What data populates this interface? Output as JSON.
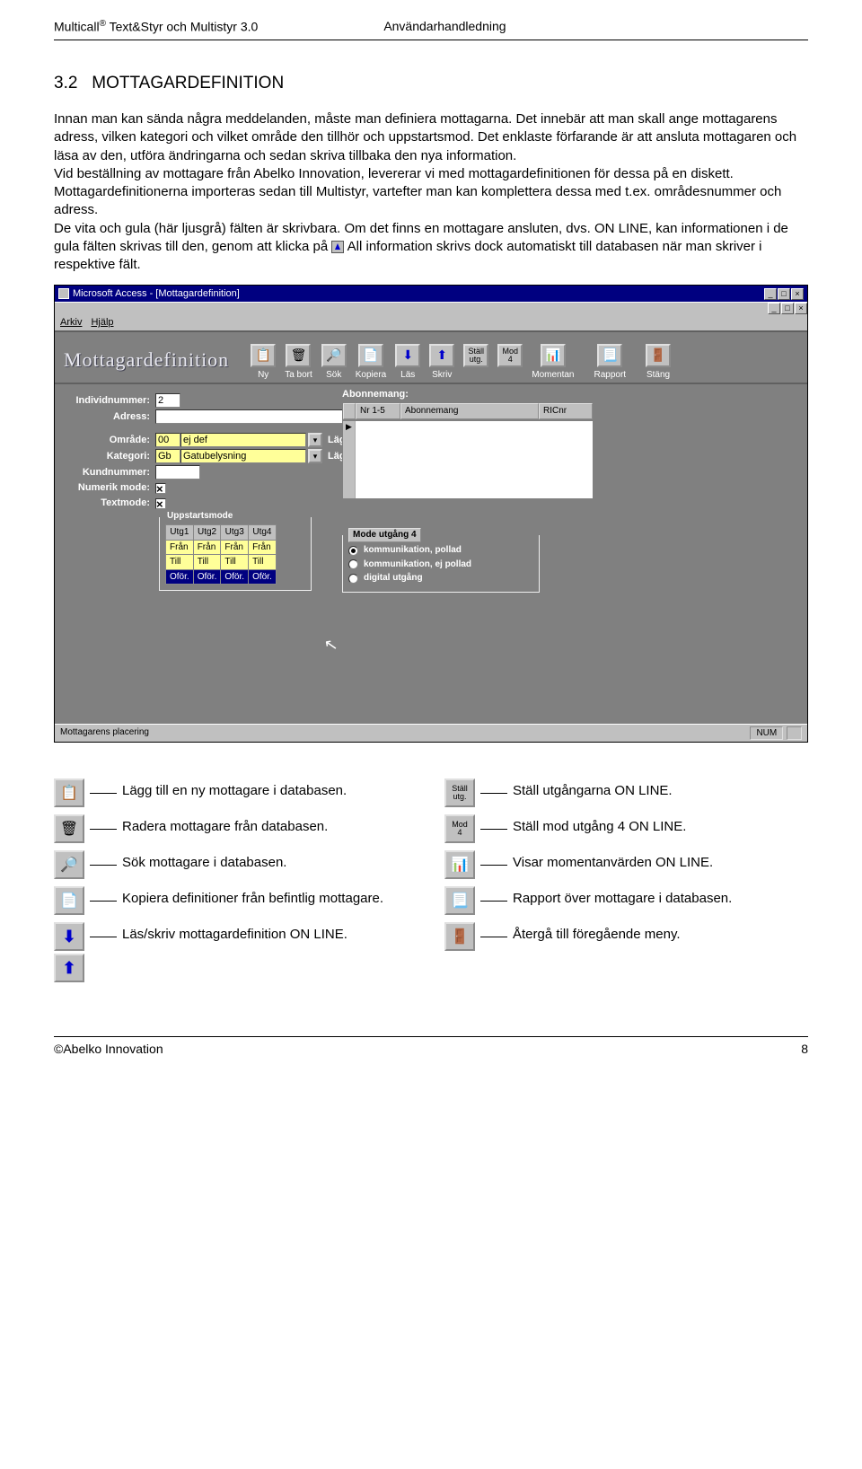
{
  "header": {
    "left_a": "Multicall",
    "left_sup": "®",
    "left_b": "Text&Styr och Multistyr 3.0",
    "right": "Användarhandledning"
  },
  "section": {
    "number": "3.2",
    "title": "MOTTAGARDEFINITION"
  },
  "body_text": "Innan man kan sända några meddelanden, måste man definiera mottagarna. Det innebär att man skall ange mottagarens adress, vilken kategori och vilket område den tillhör och uppstartsmod. Det enklaste förfarande är att ansluta mottagaren och läsa av den, utföra ändringarna och sedan skriva tillbaka den nya information.\nVid beställning av mottagare från Abelko Innovation, levererar vi med mottagardefinitionen för dessa på en diskett. Mottagardefinitionerna importeras sedan till Multistyr, vartefter man kan komplettera dessa med t.ex. områdesnummer och adress.\nDe vita och gula (här ljusgrå) fälten är skrivbara. Om det finns en mottagare ansluten, dvs. ON LINE, kan informationen i de gula fälten skrivas till den, genom att klicka på ",
  "body_text_after": " All information skrivs dock automatiskt till databasen när man skriver i respektive fält.",
  "screenshot": {
    "title": "Microsoft Access - [Mottagardefinition]",
    "menu": [
      "Arkiv",
      "Hjälp"
    ],
    "window_title": "Mottagardefinition",
    "toolbar": {
      "ny": "Ny",
      "tabort": "Ta bort",
      "sok": "Sök",
      "kopiera": "Kopiera",
      "las": "Läs",
      "skriv": "Skriv",
      "stall": "Ställ\nutg.",
      "mod4": "Mod\n4",
      "momentan": "Momentan",
      "rapport": "Rapport",
      "stang": "Stäng"
    },
    "fields": {
      "individ_lbl": "Individnummer:",
      "individ_val": "2",
      "adress_lbl": "Adress:",
      "adress_val": "",
      "omrade_lbl": "Område:",
      "omrade_code": "00",
      "omrade_val": "ej def",
      "lagg_till": "Lägg till",
      "kategori_lbl": "Kategori:",
      "kategori_code": "Gb",
      "kategori_val": "Gatubelysning",
      "kundnummer_lbl": "Kundnummer:",
      "numerik_lbl": "Numerik mode:",
      "textmode_lbl": "Textmode:"
    },
    "abonnemang": {
      "title": "Abonnemang:",
      "cols": [
        "Nr 1-5",
        "Abonnemang",
        "RICnr"
      ]
    },
    "uppstart": {
      "title": "Uppstartsmode",
      "heads": [
        "Utg1",
        "Utg2",
        "Utg3",
        "Utg4"
      ],
      "r1": [
        "Från",
        "Från",
        "Från",
        "Från"
      ],
      "r2": [
        "Till",
        "Till",
        "Till",
        "Till"
      ],
      "r3": [
        "Oför.",
        "Oför.",
        "Oför.",
        "Oför."
      ]
    },
    "mode4": {
      "title": "Mode utgång 4",
      "opts": [
        "kommunikation, pollad",
        "kommunikation, ej pollad",
        "digital utgång"
      ]
    },
    "status_left": "Mottagarens placering",
    "status_right": "NUM"
  },
  "legend": {
    "l1": "Lägg till en ny mottagare i databasen.",
    "l2": "Radera mottagare från databasen.",
    "l3": "Sök mottagare i databasen.",
    "l4": "Kopiera definitioner från befintlig mottagare.",
    "l5": "Läs/skriv mottagardefinition ON LINE.",
    "r1": "Ställ utgångarna ON LINE.",
    "r1_icon": "Ställ\nutg.",
    "r2": "Ställ mod utgång 4 ON LINE.",
    "r2_icon": "Mod\n4",
    "r3": "Visar momentanvärden ON LINE.",
    "r4": "Rapport över mottagare i databasen.",
    "r5": "Återgå till föregående meny."
  },
  "footer": {
    "left": "©Abelko Innovation",
    "right": "8"
  }
}
